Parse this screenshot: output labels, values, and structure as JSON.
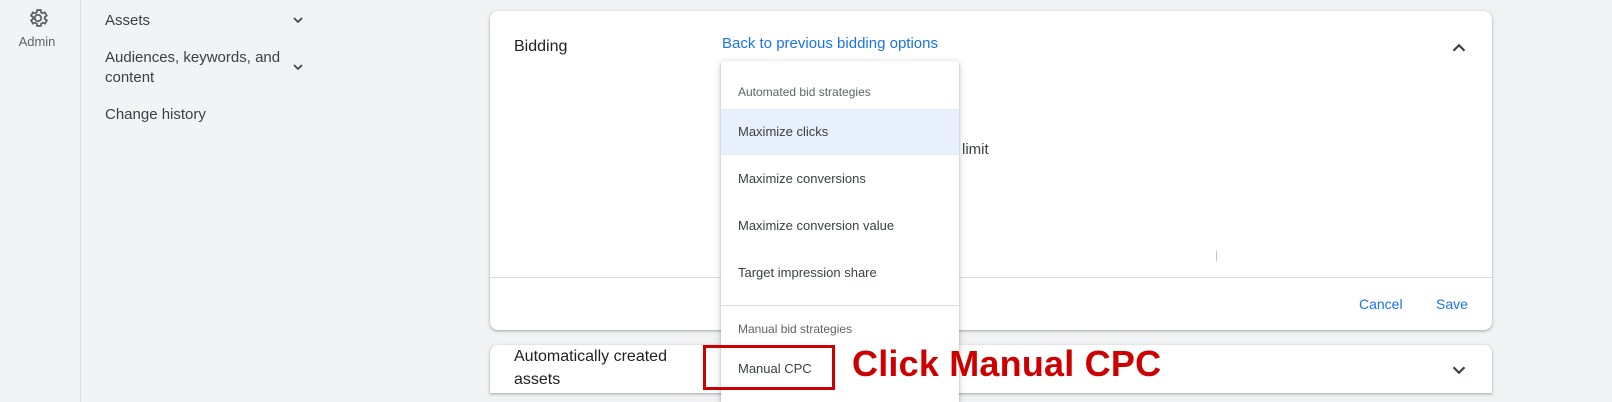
{
  "rail": {
    "admin_label": "Admin",
    "icon": "gear-icon"
  },
  "nav": {
    "items": [
      {
        "label": "Assets",
        "has_chevron": true
      },
      {
        "label": "Audiences, keywords, and content",
        "has_chevron": true
      },
      {
        "label": "Change history",
        "has_chevron": false
      }
    ]
  },
  "bidding": {
    "title": "Bidding",
    "back_link": "Back to previous bidding options",
    "limit_fragment": "limit",
    "cancel": "Cancel",
    "save": "Save"
  },
  "menu": {
    "automated_header": "Automated bid strategies",
    "automated_items": [
      "Maximize clicks",
      "Maximize conversions",
      "Maximize conversion value",
      "Target impression share"
    ],
    "manual_header": "Manual bid strategies",
    "manual_items": [
      "Manual CPC"
    ],
    "active_item": "Maximize clicks"
  },
  "auto_assets": {
    "title": "Automatically created assets"
  },
  "annotation": {
    "text": "Click Manual CPC"
  },
  "colors": {
    "accent": "#1a73e8",
    "annotation": "#cc0000",
    "hover": "#e8f0fe"
  }
}
